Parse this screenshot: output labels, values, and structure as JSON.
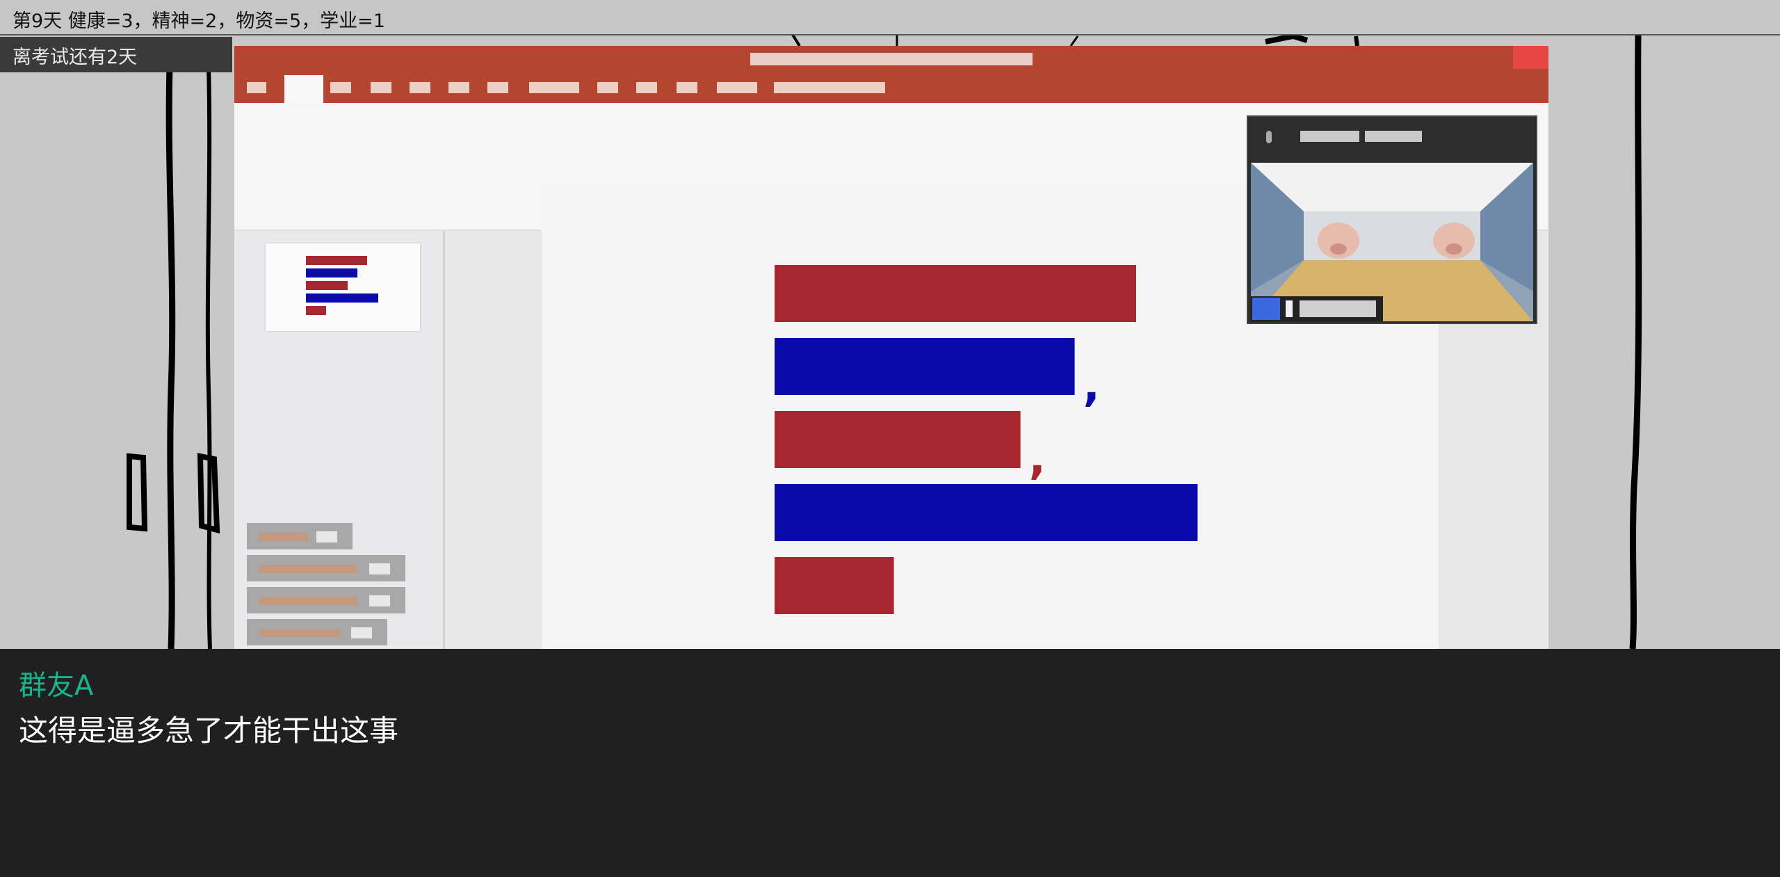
{
  "status": {
    "text": "第9天 健康=3，精神=2，物资=5，学业=1"
  },
  "countdown": {
    "text": "离考试还有2天"
  },
  "slide_chart": {
    "type": "bar",
    "orientation": "horizontal",
    "bars": [
      {
        "value": 100,
        "color": "#a8262f"
      },
      {
        "value": 83,
        "color": "#0a0aa8",
        "mark": ","
      },
      {
        "value": 68,
        "color": "#a8262f",
        "mark": ","
      },
      {
        "value": 117,
        "color": "#0a0aa8"
      },
      {
        "value": 33,
        "color": "#a8262f"
      }
    ]
  },
  "colors": {
    "ppt_titlebar": "#b4452e",
    "bar_red": "#a8262f",
    "bar_blue": "#0a0aa8",
    "speaker_name": "#19b38c"
  },
  "dialog": {
    "speaker": "群友A",
    "text": "这得是逼多急了才能干出这事"
  }
}
